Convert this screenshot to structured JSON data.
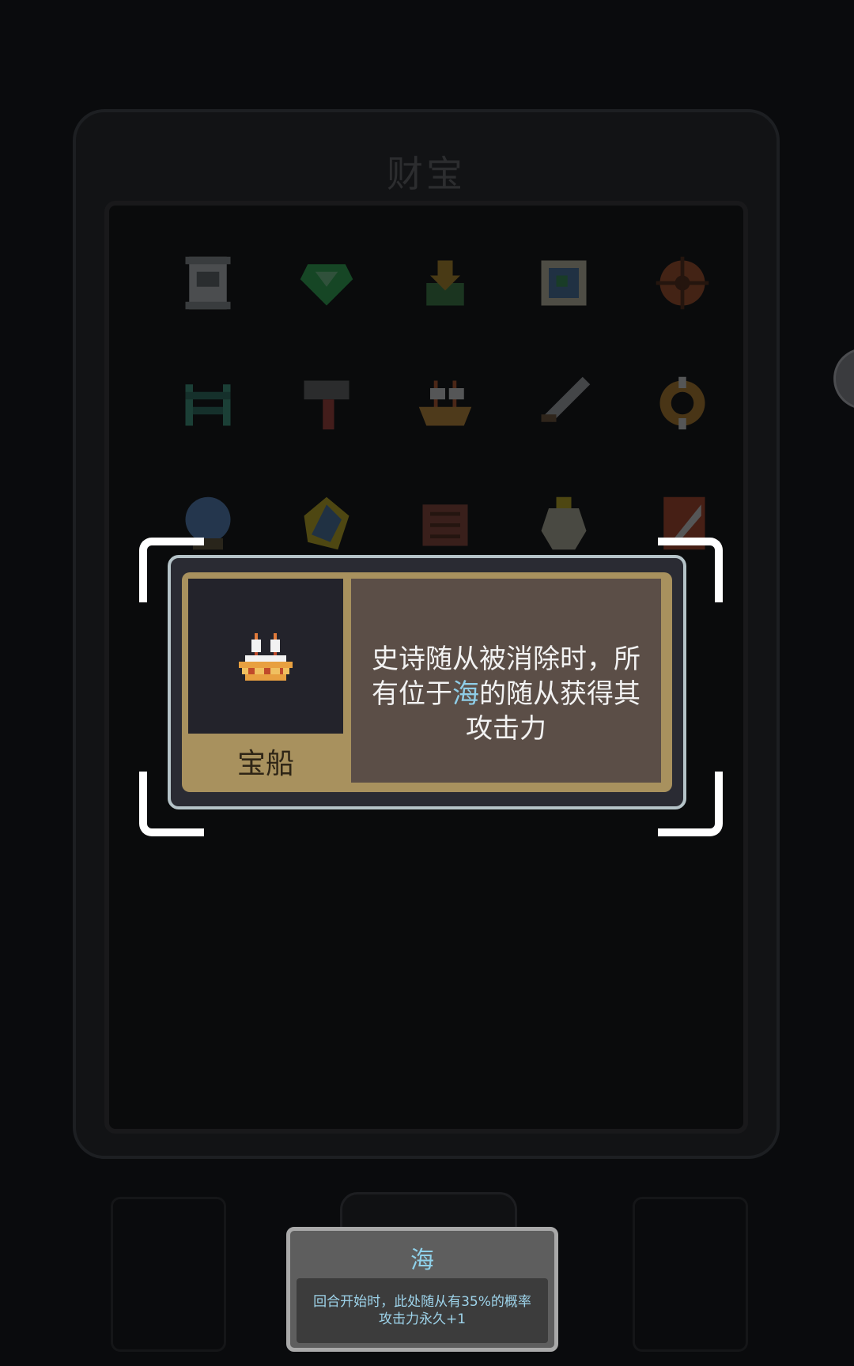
{
  "panel": {
    "title": "财宝",
    "items": [
      {
        "icon": "scroll-icon",
        "color": "#cfd3d6"
      },
      {
        "icon": "emerald-gem-icon",
        "color": "#2fbf5a"
      },
      {
        "icon": "anchor-icon",
        "color": "#3f8a4a"
      },
      {
        "icon": "treasure-map-icon",
        "color": "#4f7fb4"
      },
      {
        "icon": "ship-wheel-icon",
        "color": "#b7542a"
      },
      {
        "icon": "gate-icon",
        "color": "#3fa88d"
      },
      {
        "icon": "hammer-icon",
        "color": "#6e6f72"
      },
      {
        "icon": "treasure-ship-icon",
        "color": "#d99a3a"
      },
      {
        "icon": "sword-icon",
        "color": "#b9bec2"
      },
      {
        "icon": "lifebuoy-icon",
        "color": "#c98a2c"
      },
      {
        "icon": "crystal-ball-icon",
        "color": "#5a8fd0"
      },
      {
        "icon": "crystal-shard-icon",
        "color": "#d7c020"
      },
      {
        "icon": "chest-icon",
        "color": "#9a4a3a"
      },
      {
        "icon": "vase-icon",
        "color": "#c8c8b0"
      },
      {
        "icon": "flag-icon",
        "color": "#c0482a"
      }
    ]
  },
  "detail": {
    "name": "宝船",
    "description_before": "史诗随从被消除时，所有位于",
    "description_keyword": "海",
    "description_after": "的随从获得其攻击力",
    "icon": "treasure-ship-icon"
  },
  "tooltip": {
    "title": "海",
    "body_line1": "回合开始时，此处随从有35%的概率",
    "body_line2": "攻击力永久+1"
  },
  "colors": {
    "keyword": "#8fcde7",
    "card_border": "#b5c3c8",
    "card_gold": "#a8915e",
    "desc_bg": "#5b4e47"
  }
}
